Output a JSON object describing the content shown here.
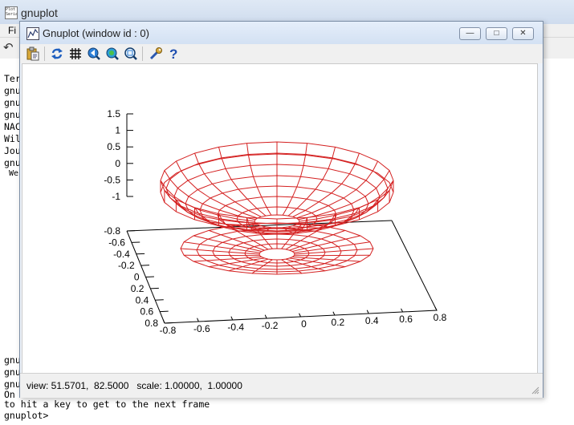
{
  "console_window": {
    "title": "gnuplot",
    "menu_first": "Fi",
    "icon_glyph": "↶",
    "lines": [
      {
        "id": 0,
        "text": "Ter"
      },
      {
        "id": 1,
        "text": "gnu"
      },
      {
        "id": 2,
        "text": "gnu"
      },
      {
        "id": 3,
        "text": "gnu"
      },
      {
        "id": 4,
        "text": "NAC"
      },
      {
        "id": 5,
        "text": "Wil"
      },
      {
        "id": 6,
        "text": "Jou"
      },
      {
        "id": 7,
        "text": "gnu"
      },
      {
        "id": 8,
        "text": " We"
      },
      {
        "id": 9,
        "text": "gnu"
      },
      {
        "id": 10,
        "text": "gnu"
      },
      {
        "id": 11,
        "text": "gnu"
      },
      {
        "id": 12,
        "text": "On"
      },
      {
        "id": 13,
        "text": "to hit a key to get to the next frame"
      },
      {
        "id": 14,
        "text": "gnuplot>"
      }
    ]
  },
  "plot_window": {
    "title": "Gnuplot (window id : 0)",
    "controls": {
      "minimize": "—",
      "maximize": "□",
      "close": "✕"
    },
    "toolbar": [
      {
        "name": "copy-clipboard-icon"
      },
      {
        "name": "replot-icon"
      },
      {
        "name": "grid-icon"
      },
      {
        "name": "zoom-previous-icon"
      },
      {
        "name": "zoom-next-icon"
      },
      {
        "name": "unzoom-icon"
      },
      {
        "name": "options-icon"
      },
      {
        "name": "help-icon"
      }
    ],
    "status": "view: 51.5701,  82.5000   scale: 1.00000,  1.00000"
  },
  "chart_data": {
    "type": "surface",
    "title": "",
    "surface_color": "#d42020",
    "view": [
      51.5701,
      82.5
    ],
    "x_ticks": [
      "-0.8",
      "-0.6",
      "-0.4",
      "-0.2",
      "0",
      "0.2",
      "0.4",
      "0.6",
      "0.8"
    ],
    "y_ticks": [
      "-0.8",
      "-0.6",
      "-0.4",
      "-0.2",
      "0",
      "0.2",
      "0.4",
      "0.6",
      "0.8"
    ],
    "z_ticks": [
      "-1",
      "-0.5",
      "0",
      "0.5",
      "1",
      "1.5"
    ],
    "xlim": [
      -0.8,
      0.8
    ],
    "ylim": [
      -0.8,
      0.8
    ],
    "zlim": [
      -1.5,
      1.5
    ]
  }
}
